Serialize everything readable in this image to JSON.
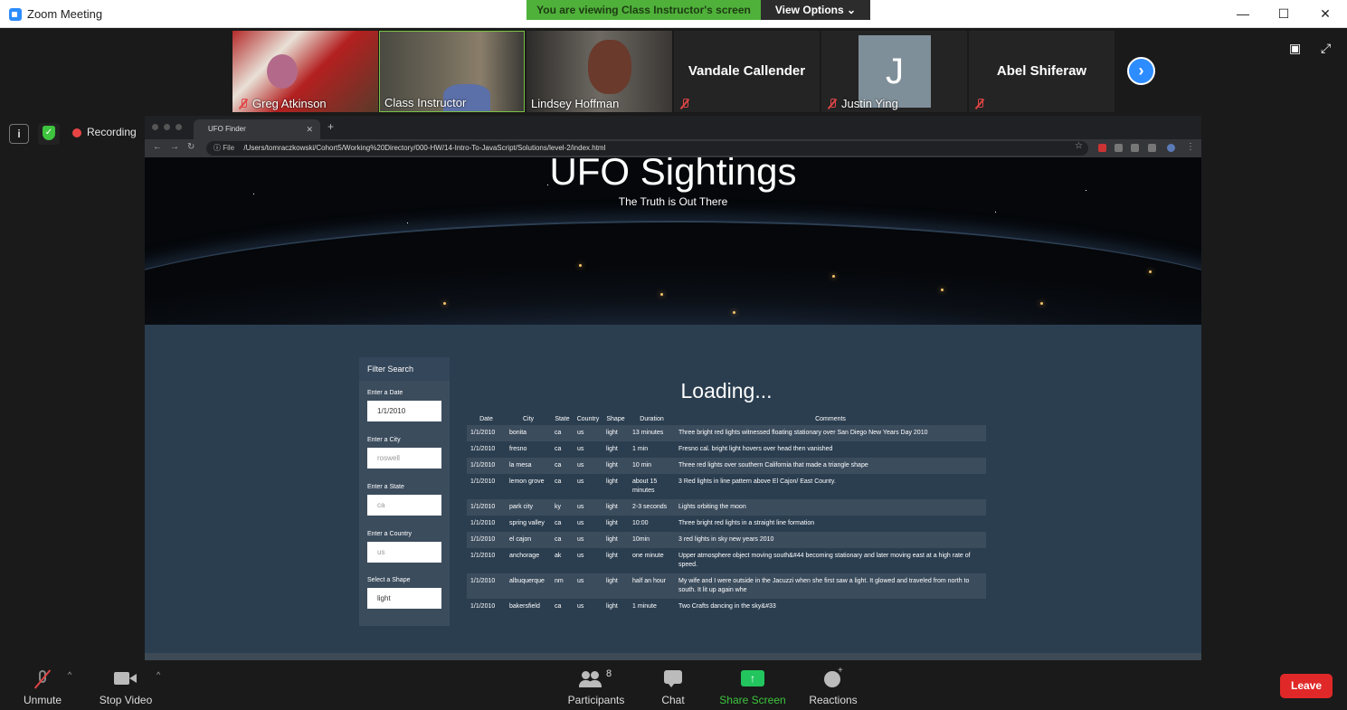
{
  "window": {
    "title": "Zoom Meeting"
  },
  "banner": {
    "viewing": "You are viewing Class Instructor's screen",
    "view_options": "View Options"
  },
  "participants_strip": [
    {
      "name": "Greg Atkinson",
      "type": "video"
    },
    {
      "name": "Class Instructor",
      "type": "video"
    },
    {
      "name": "Lindsey Hoffman",
      "type": "video"
    },
    {
      "name": "Vandale Callender",
      "type": "name"
    },
    {
      "name": "Justin Ying",
      "type": "avatar",
      "initial": "J"
    },
    {
      "name": "Abel Shiferaw",
      "type": "name"
    }
  ],
  "status": {
    "recording": "Recording"
  },
  "browser": {
    "tab_title": "UFO Finder",
    "url_prefix": "File",
    "url": "/Users/tomraczkowski/Cohort5/Working%20Directory/000-HW/14-Intro-To-JavaScript/Solutions/level-2/index.html"
  },
  "page": {
    "title": "UFO Sightings",
    "subtitle": "The Truth is Out There",
    "loading": "Loading...",
    "filter": {
      "heading": "Filter Search",
      "fields": [
        {
          "label": "Enter a Date",
          "value": "1/1/2010",
          "placeholder": ""
        },
        {
          "label": "Enter a City",
          "value": "",
          "placeholder": "roswell"
        },
        {
          "label": "Enter a State",
          "value": "",
          "placeholder": "ca"
        },
        {
          "label": "Enter a Country",
          "value": "",
          "placeholder": "us"
        },
        {
          "label": "Select a Shape",
          "value": "light",
          "placeholder": ""
        }
      ]
    },
    "table": {
      "headers": [
        "Date",
        "City",
        "State",
        "Country",
        "Shape",
        "Duration",
        "Comments"
      ],
      "rows": [
        [
          "1/1/2010",
          "bonita",
          "ca",
          "us",
          "light",
          "13 minutes",
          "Three bright red lights witnessed floating stationary over San Diego New Years Day 2010"
        ],
        [
          "1/1/2010",
          "fresno",
          "ca",
          "us",
          "light",
          "1 min",
          "Fresno cal. bright light hovers over head then vanished"
        ],
        [
          "1/1/2010",
          "la mesa",
          "ca",
          "us",
          "light",
          "10 min",
          "Three red lights over southern California that made a triangle shape"
        ],
        [
          "1/1/2010",
          "lemon grove",
          "ca",
          "us",
          "light",
          "about 15 minutes",
          "3 Red lights in line pattern above El Cajon/ East County."
        ],
        [
          "1/1/2010",
          "park city",
          "ky",
          "us",
          "light",
          "2-3 seconds",
          "Lights orbiting the moon"
        ],
        [
          "1/1/2010",
          "spring valley",
          "ca",
          "us",
          "light",
          "10:00",
          "Three bright red lights in a straight line formation"
        ],
        [
          "1/1/2010",
          "el cajon",
          "ca",
          "us",
          "light",
          "10min",
          "3 red lights in sky new years 2010"
        ],
        [
          "1/1/2010",
          "anchorage",
          "ak",
          "us",
          "light",
          "one minute",
          "Upper atmosphere object moving south&#44 becoming stationary and later moving east at a high rate of speed."
        ],
        [
          "1/1/2010",
          "albuquerque",
          "nm",
          "us",
          "light",
          "half an hour",
          "My wife and I were outside in the Jacuzzi when she first saw a light. It glowed and traveled from north to south. It lit up again whe"
        ],
        [
          "1/1/2010",
          "bakersfield",
          "ca",
          "us",
          "light",
          "1 minute",
          "Two Crafts dancing in the sky&#33"
        ]
      ]
    }
  },
  "toolbar": {
    "unmute": "Unmute",
    "stop_video": "Stop Video",
    "participants": "Participants",
    "participants_count": "8",
    "chat": "Chat",
    "share_screen": "Share Screen",
    "reactions": "Reactions",
    "leave": "Leave"
  },
  "colors": {
    "accent": "#2d8cff",
    "banner_green": "#4fb13a",
    "share_green": "#22c55e",
    "leave_red": "#e02828",
    "page_bg": "#2b3e50"
  }
}
